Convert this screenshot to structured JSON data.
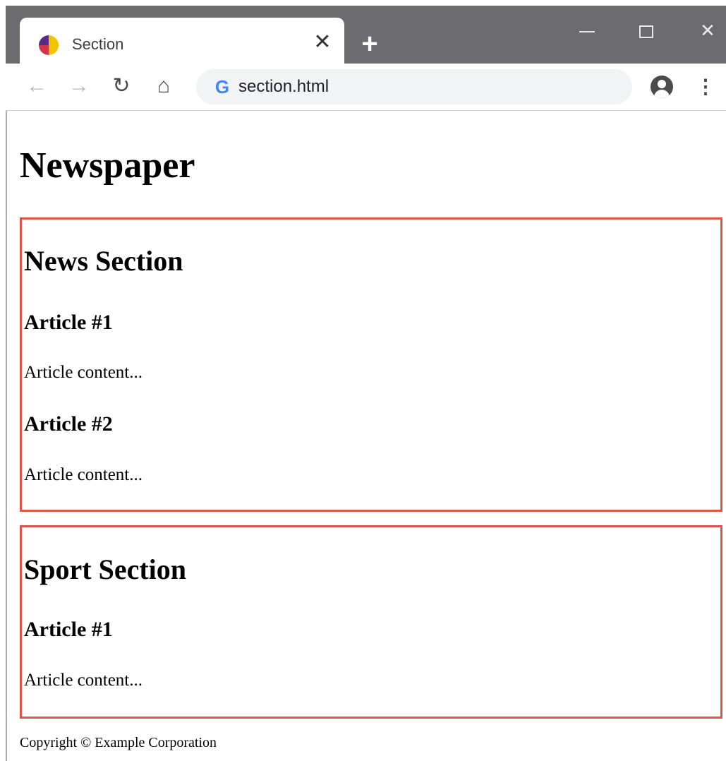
{
  "browser": {
    "tab_title": "Section",
    "tab_close_glyph": "✕",
    "new_tab_glyph": "+",
    "url": "section.html",
    "omnibox_icon_glyph": "G",
    "window_controls": {
      "close_glyph": "✕"
    },
    "nav": {
      "back_glyph": "←",
      "forward_glyph": "→",
      "reload_glyph": "↻",
      "home_glyph": "⌂",
      "menu_glyph": "⋮"
    },
    "colors": {
      "titlebar": "#6c6b70",
      "omnibox": "#f1f3f4",
      "section_border": "#d9574a"
    }
  },
  "page": {
    "title": "Newspaper",
    "sections": [
      {
        "heading": "News Section",
        "articles": [
          {
            "heading": "Article #1",
            "content": "Article content..."
          },
          {
            "heading": "Article #2",
            "content": "Article content..."
          }
        ]
      },
      {
        "heading": "Sport Section",
        "articles": [
          {
            "heading": "Article #1",
            "content": "Article content..."
          }
        ]
      }
    ],
    "footer": "Copyright © Example Corporation"
  }
}
